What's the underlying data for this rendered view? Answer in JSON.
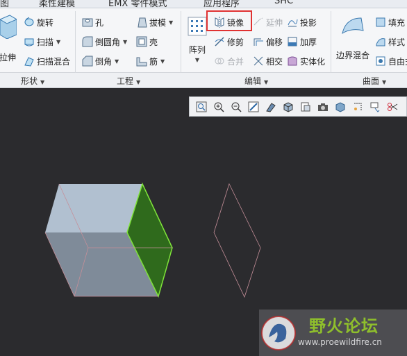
{
  "tabs": [
    "图",
    "柔性建模",
    "EMX 零件模式",
    "应用程序",
    "SHC"
  ],
  "groups": {
    "shape": {
      "label": "形状",
      "big_button": "拉伸",
      "commands": [
        "旋转",
        "扫描",
        "扫描混合"
      ]
    },
    "engineering": {
      "label": "工程",
      "commands": [
        "孔",
        "倒圆角",
        "倒角",
        "拔模",
        "壳",
        "筋"
      ]
    },
    "editing": {
      "label": "编辑",
      "big_button": "阵列",
      "commands": [
        "镜像",
        "修剪",
        "合并",
        "延伸",
        "偏移",
        "相交",
        "投影",
        "加厚",
        "实体化"
      ]
    },
    "surfaces": {
      "label": "曲面",
      "big_button": "边界混合",
      "commands": [
        "填充",
        "样式",
        "自由式"
      ]
    }
  },
  "colors": {
    "canvas_bg": "#2b2b2e",
    "cube_top": "#b1c0d0",
    "cube_front": "#7f8b99",
    "cube_selected_face": "#2f6a1c",
    "edge_color": "#c58f99",
    "highlight_box": "#e03232"
  },
  "watermark": {
    "title": "野火论坛",
    "url": "www.proewildfire.cn"
  }
}
